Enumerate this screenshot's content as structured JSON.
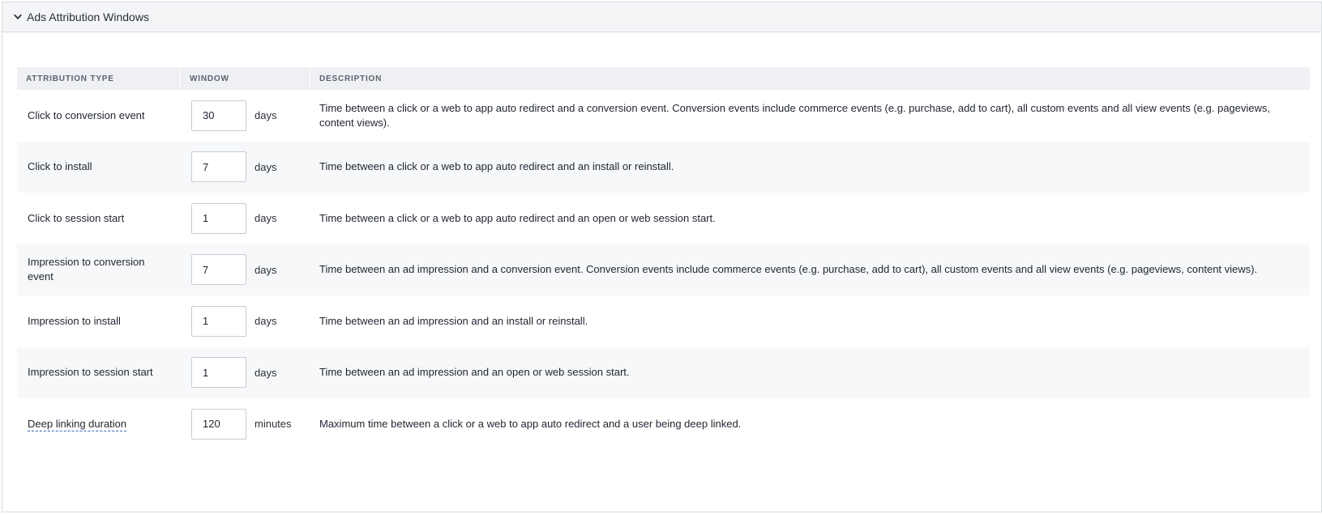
{
  "panel": {
    "title": "Ads Attribution Windows"
  },
  "table": {
    "headers": {
      "type": "ATTRIBUTION TYPE",
      "window": "WINDOW",
      "description": "DESCRIPTION"
    },
    "rows": [
      {
        "type": "Click to conversion event",
        "value": "30",
        "unit": "days",
        "description": "Time between a click or a web to app auto redirect and a conversion event. Conversion events include commerce events (e.g. purchase, add to cart), all custom events and all view events (e.g. pageviews, content views)."
      },
      {
        "type": "Click to install",
        "value": "7",
        "unit": "days",
        "description": "Time between a click or a web to app auto redirect and an install or reinstall."
      },
      {
        "type": "Click to session start",
        "value": "1",
        "unit": "days",
        "description": "Time between a click or a web to app auto redirect and an open or web session start."
      },
      {
        "type": "Impression to conversion event",
        "value": "7",
        "unit": "days",
        "description": "Time between an ad impression and a conversion event. Conversion events include commerce events (e.g. purchase, add to cart), all custom events and all view events (e.g. pageviews, content views)."
      },
      {
        "type": "Impression to install",
        "value": "1",
        "unit": "days",
        "description": "Time between an ad impression and an install or reinstall."
      },
      {
        "type": "Impression to session start",
        "value": "1",
        "unit": "days",
        "description": "Time between an ad impression and an open or web session start."
      },
      {
        "type": "Deep linking duration",
        "value": "120",
        "unit": "minutes",
        "description": "Maximum time between a click or a web to app auto redirect and a user being deep linked."
      }
    ]
  },
  "icons": {
    "collapse": "chevron-down-icon"
  }
}
